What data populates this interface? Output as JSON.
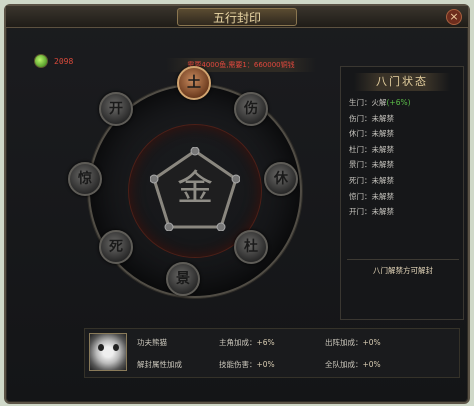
{
  "window": {
    "title": "五行封印",
    "close": "×"
  },
  "resource": {
    "value": "2098"
  },
  "requirement": "需要4000鱼,需要1：660000铜钱",
  "wheel": {
    "center_glyph": "金",
    "nodes": [
      {
        "label": "土",
        "state": "active"
      },
      {
        "label": "伤",
        "state": "locked"
      },
      {
        "label": "休",
        "state": "locked"
      },
      {
        "label": "杜",
        "state": "locked"
      },
      {
        "label": "景",
        "state": "locked"
      },
      {
        "label": "死",
        "state": "locked"
      },
      {
        "label": "惊",
        "state": "locked"
      },
      {
        "label": "开",
        "state": "locked"
      }
    ]
  },
  "status_panel": {
    "title": "八门状态",
    "rows": [
      {
        "gate": "生门：",
        "state": "火解",
        "bonus": "(+6%)"
      },
      {
        "gate": "伤门：",
        "state": "未解禁",
        "bonus": ""
      },
      {
        "gate": "休门：",
        "state": "未解禁",
        "bonus": ""
      },
      {
        "gate": "杜门：",
        "state": "未解禁",
        "bonus": ""
      },
      {
        "gate": "景门：",
        "state": "未解禁",
        "bonus": ""
      },
      {
        "gate": "死门：",
        "state": "未解禁",
        "bonus": ""
      },
      {
        "gate": "惊门：",
        "state": "未解禁",
        "bonus": ""
      },
      {
        "gate": "开门：",
        "state": "未解禁",
        "bonus": ""
      }
    ],
    "note": "八门解禁方可解封"
  },
  "footer": {
    "character": "功夫熊猫",
    "attr_label": "解封属性加成",
    "stats": [
      {
        "label": "主角加成：",
        "value": "+6%"
      },
      {
        "label": "出阵加成：",
        "value": "+0%"
      },
      {
        "label": "技能伤害：",
        "value": "+0%"
      },
      {
        "label": "全队加成：",
        "value": "+0%"
      }
    ]
  }
}
